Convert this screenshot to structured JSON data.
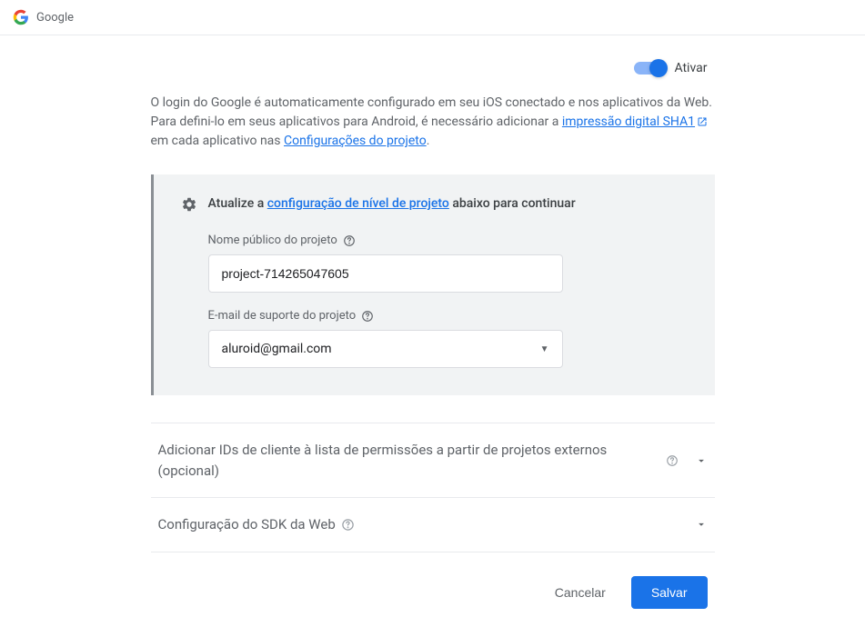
{
  "header": {
    "title": "Google"
  },
  "toggle": {
    "label": "Ativar"
  },
  "intro": {
    "line1_prefix": "O login do Google é automaticamente configurado em seu iOS conectado e nos aplicativos da Web. Para defini-lo em seus aplicativos para Android, é necessário adicionar a ",
    "link1": "impressão digital SHA1",
    "line2_prefix": " em cada aplicativo nas ",
    "link2": "Configurações do projeto",
    "line2_suffix": "."
  },
  "config": {
    "heading_prefix": "Atualize a ",
    "heading_link": "configuração de nível de projeto",
    "heading_suffix": " abaixo para continuar",
    "project_name_label": "Nome público do projeto",
    "project_name_value": "project-714265047605",
    "support_email_label": "E-mail de suporte do projeto",
    "support_email_value": "aluroid@gmail.com"
  },
  "accordion": {
    "item1": "Adicionar IDs de cliente à lista de permissões a partir de projetos externos (opcional)",
    "item2": "Configuração do SDK da Web"
  },
  "footer": {
    "cancel": "Cancelar",
    "save": "Salvar"
  }
}
